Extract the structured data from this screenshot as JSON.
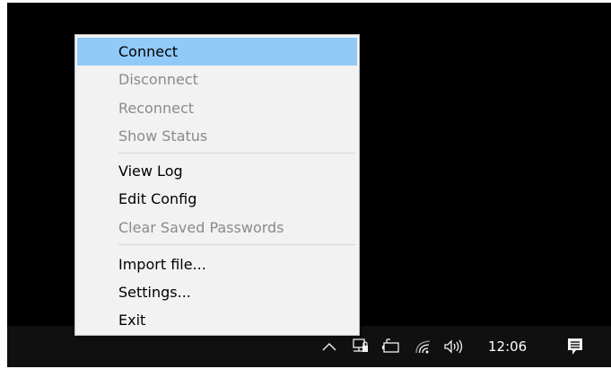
{
  "menu": {
    "items": [
      {
        "label": "Connect",
        "state": "highlighted"
      },
      {
        "label": "Disconnect",
        "state": "disabled"
      },
      {
        "label": "Reconnect",
        "state": "disabled"
      },
      {
        "label": "Show Status",
        "state": "disabled"
      },
      {
        "label": "View Log",
        "state": "enabled"
      },
      {
        "label": "Edit Config",
        "state": "enabled"
      },
      {
        "label": "Clear Saved Passwords",
        "state": "disabled"
      },
      {
        "label": "Import file...",
        "state": "enabled"
      },
      {
        "label": "Settings...",
        "state": "enabled"
      },
      {
        "label": "Exit",
        "state": "enabled"
      }
    ]
  },
  "taskbar": {
    "tray_icons": [
      "chevron-up-icon",
      "vpn-network-icon",
      "battery-icon",
      "wifi-icon",
      "volume-icon"
    ],
    "clock": "12:06",
    "notification_icon": "action-center-icon"
  },
  "colors": {
    "menu_background": "#f2f2f2",
    "highlight": "#91c9f7",
    "disabled_text": "#8a8a8a",
    "taskbar": "#101010",
    "desktop": "#000000"
  }
}
